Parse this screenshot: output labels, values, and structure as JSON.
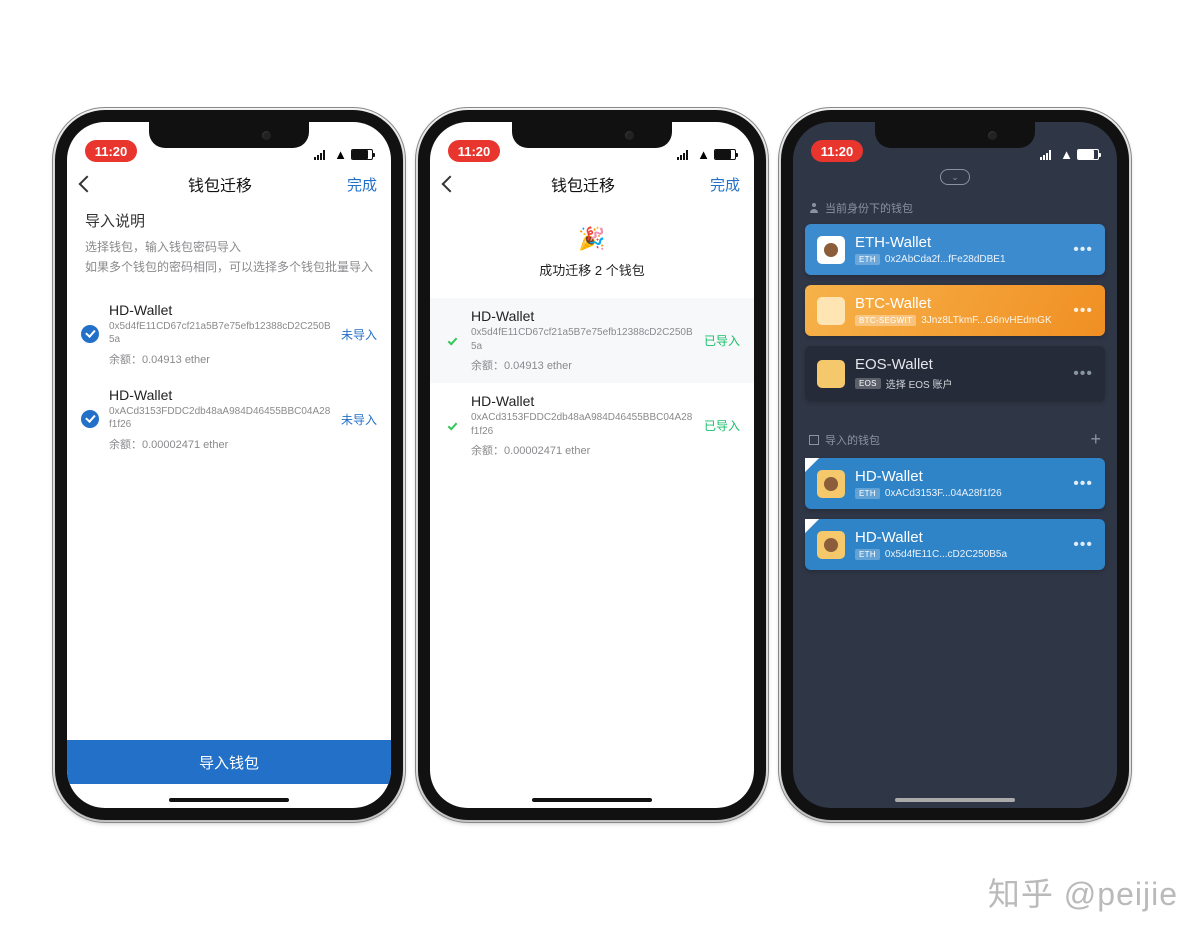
{
  "status_time": "11:20",
  "watermark": "知乎 @peijie",
  "screen1": {
    "nav_title": "钱包迁移",
    "nav_done": "完成",
    "intro_heading": "导入说明",
    "intro_line1": "选择钱包，输入钱包密码导入",
    "intro_line2": "如果多个钱包的密码相同，可以选择多个钱包批量导入",
    "status_label": "未导入",
    "import_button": "导入钱包",
    "wallets": [
      {
        "name": "HD-Wallet",
        "addr": "0x5d4fE11CD67cf21a5B7e75efb12388cD2C250B5a",
        "balance_label": "余额：",
        "balance_value": "0.04913 ether"
      },
      {
        "name": "HD-Wallet",
        "addr": "0xACd3153FDDC2db48aA984D46455BBC04A28f1f26",
        "balance_label": "余额：",
        "balance_value": "0.00002471 ether"
      }
    ]
  },
  "screen2": {
    "nav_title": "钱包迁移",
    "nav_done": "完成",
    "status_label": "已导入",
    "success_emoji": "🎉",
    "success_msg": "成功迁移 2 个钱包",
    "wallets": [
      {
        "name": "HD-Wallet",
        "addr": "0x5d4fE11CD67cf21a5B7e75efb12388cD2C250B5a",
        "balance_label": "余额：",
        "balance_value": "0.04913 ether"
      },
      {
        "name": "HD-Wallet",
        "addr": "0xACd3153FDDC2db48aA984D46455BBC04A28f1f26",
        "balance_label": "余额：",
        "balance_value": "0.00002471 ether"
      }
    ]
  },
  "screen3": {
    "pill": "⌄",
    "section1": "当前身份下的钱包",
    "section2": "导入的钱包",
    "identity": [
      {
        "name": "ETH-Wallet",
        "badge": "ETH",
        "addr": "0x2AbCda2f...fFe28dDBE1",
        "color": "blue"
      },
      {
        "name": "BTC-Wallet",
        "badge": "BTC-SEGWIT",
        "addr": "3Jnz8LTkmF...G6nvHEdmGK",
        "color": "orange"
      },
      {
        "name": "EOS-Wallet",
        "badge": "EOS",
        "addr": "选择 EOS 账户",
        "color": "dark"
      }
    ],
    "imported": [
      {
        "name": "HD-Wallet",
        "badge": "ETH",
        "addr": "0xACd3153F...04A28f1f26"
      },
      {
        "name": "HD-Wallet",
        "badge": "ETH",
        "addr": "0x5d4fE11C...cD2C250B5a"
      }
    ]
  }
}
